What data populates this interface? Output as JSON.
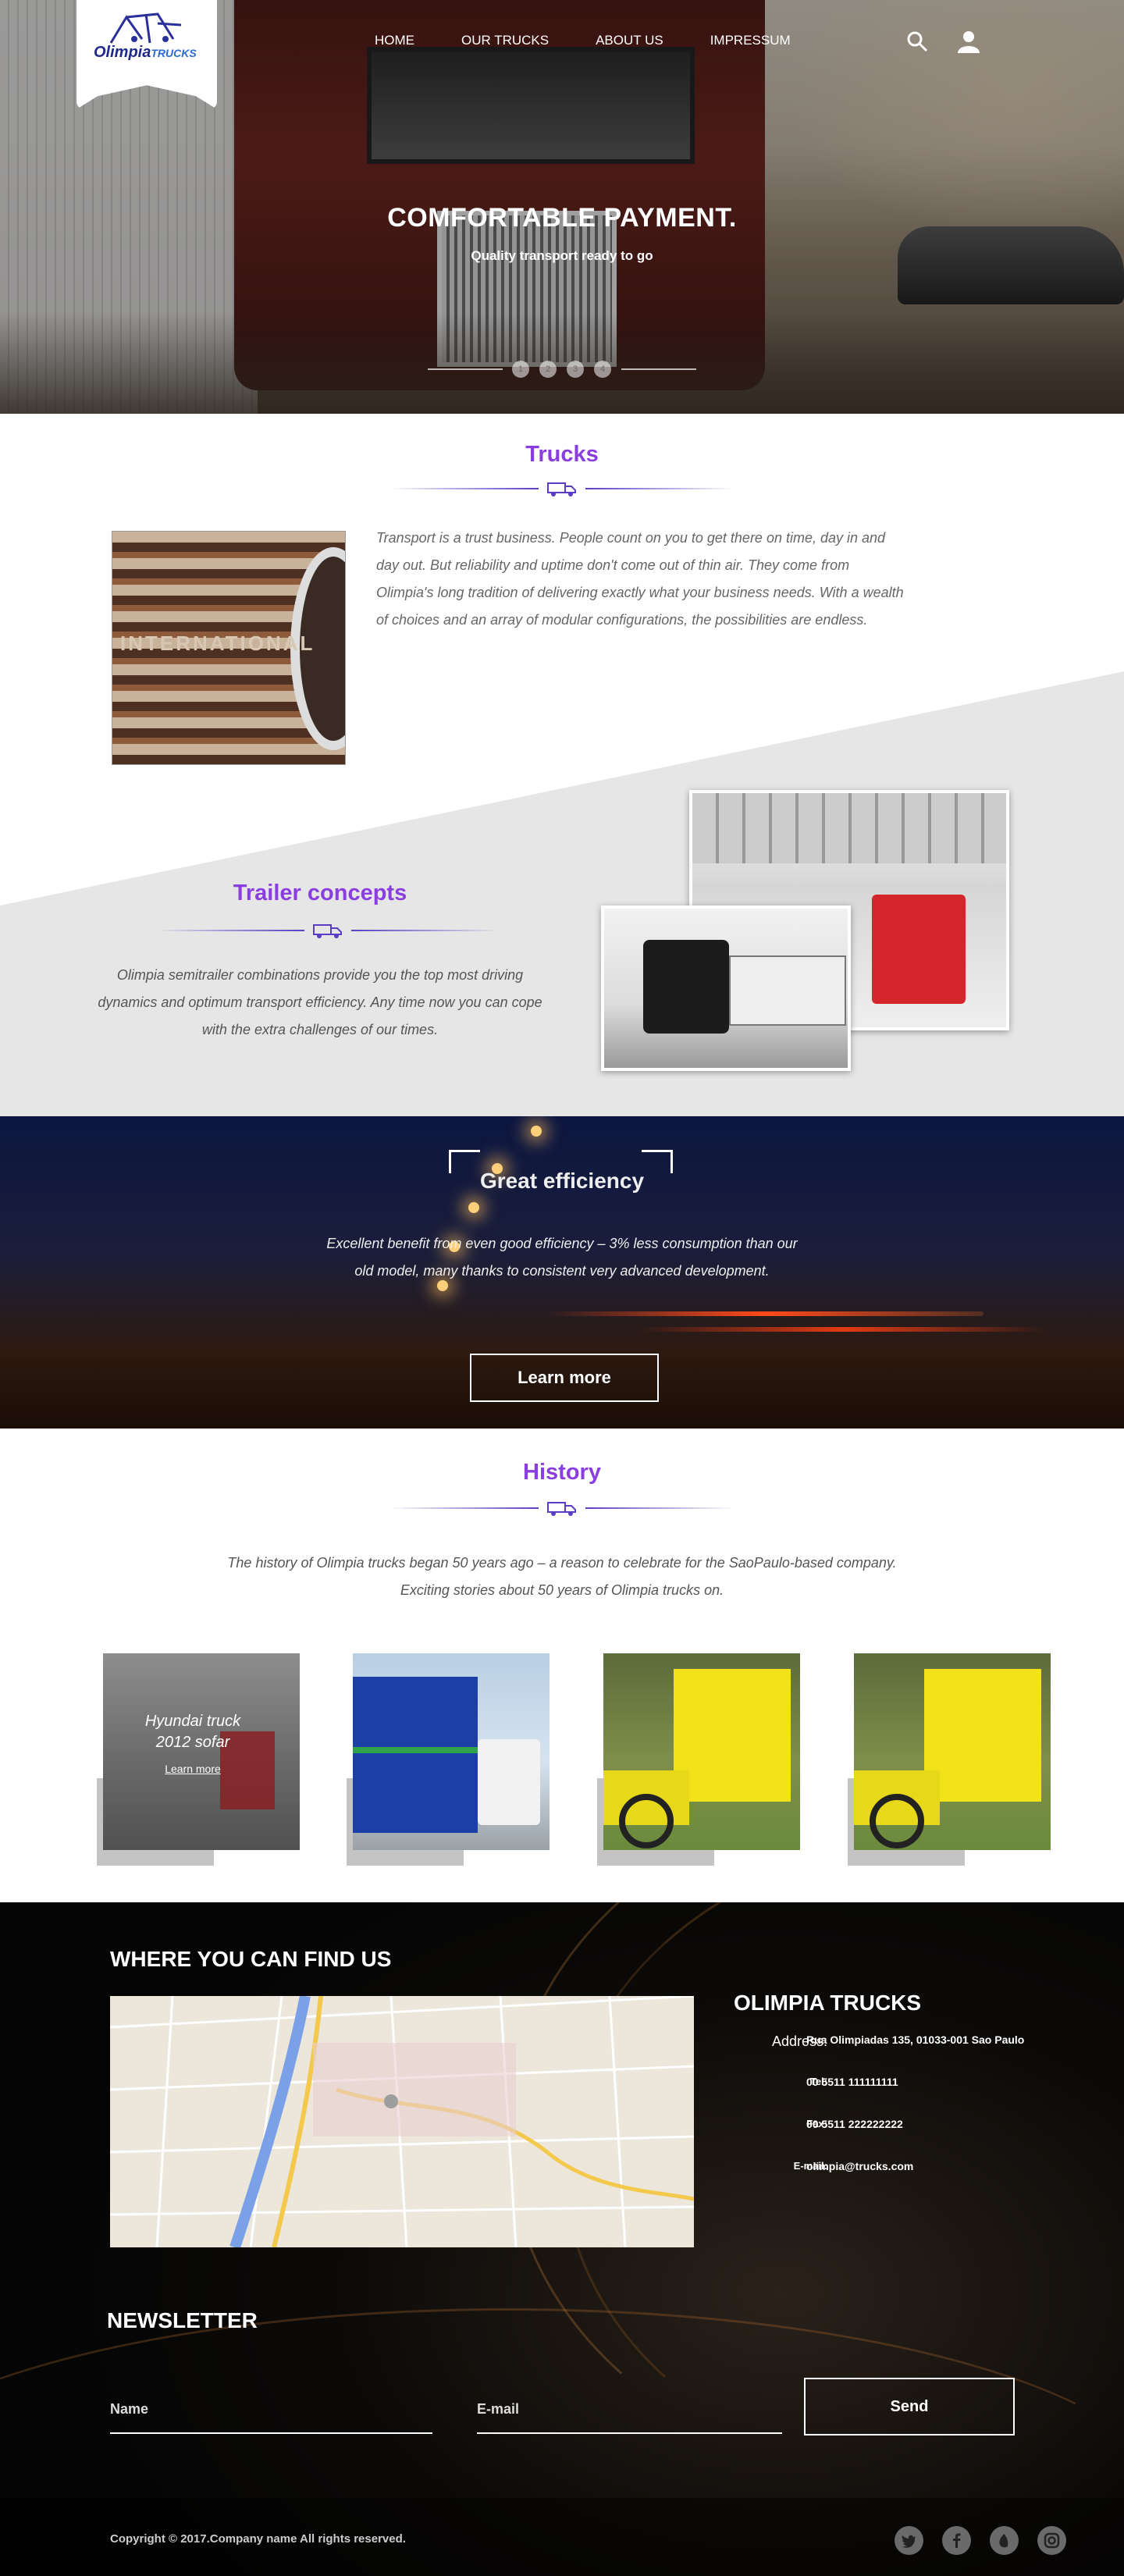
{
  "brand": {
    "name": "Olimpia",
    "sub": "TRUCKS"
  },
  "nav": {
    "items": [
      "HOME",
      "OUR TRUCKS",
      "ABOUT US",
      "IMPRESSUM"
    ],
    "icons": [
      "search-icon",
      "user-icon"
    ]
  },
  "hero": {
    "title": "COMFORTABLE PAYMENT.",
    "subtitle": "Quality transport ready to go",
    "dots": [
      "1",
      "2",
      "3",
      "4"
    ]
  },
  "trucks": {
    "title": "Trucks",
    "text": "Transport is a trust business. People count on you to get there on time, day in and day out. But reliability and uptime don't come out of thin air. They come from Olimpia's long tradition of delivering exactly what your business needs. With a wealth of choices and an array of modular configurations, the possibilities are endless.",
    "photo_badge": "INTERNATIONAL"
  },
  "trailer": {
    "title": "Trailer concepts",
    "text": "Olimpia semitrailer combinations provide you the top most driving dynamics and optimum transport efficiency. Any time now you can cope with the extra challenges of our times."
  },
  "efficiency": {
    "title": "Great efficiency",
    "text": "Excellent benefit from even good efficiency – 3% less consumption than our old model, many thanks to consistent very advanced development.",
    "button": "Learn more"
  },
  "history": {
    "title": "History",
    "text_line1": "The history of Olimpia trucks began 50 years ago – a reason to celebrate for the SaoPaulo-based company.",
    "text_line2": "Exciting stories about 50 years of Olimpia trucks on.",
    "cards": [
      {
        "caption_line1": "Hyundai truck",
        "caption_line2": "2012 sofar",
        "link": "Learn more"
      }
    ]
  },
  "find_us": {
    "title": "WHERE YOU CAN FIND US",
    "company": "OLIMPIA TRUCKS",
    "address_label": "Address:",
    "address": "Rua Olimpiadas 135, 01033-001 Sao Paulo",
    "tel_label": "Tel:",
    "tel": "00 5511 111111111",
    "fax_label": "Fax:",
    "fax": "00 5511 222222222",
    "email_label": "E-mail:",
    "email": "olimpia@trucks.com"
  },
  "newsletter": {
    "title": "NEWSLETTER",
    "name_placeholder": "Name",
    "email_placeholder": "E-mail",
    "send": "Send"
  },
  "footer": {
    "copyright": "Copyright © 2017.Company name All rights reserved.",
    "socials": [
      "twitter-icon",
      "facebook-icon",
      "dribbble-icon",
      "instagram-icon"
    ]
  },
  "colors": {
    "accent": "#8a3ee0",
    "brand": "#1f2a8a",
    "divider": "#5b3cc4"
  }
}
